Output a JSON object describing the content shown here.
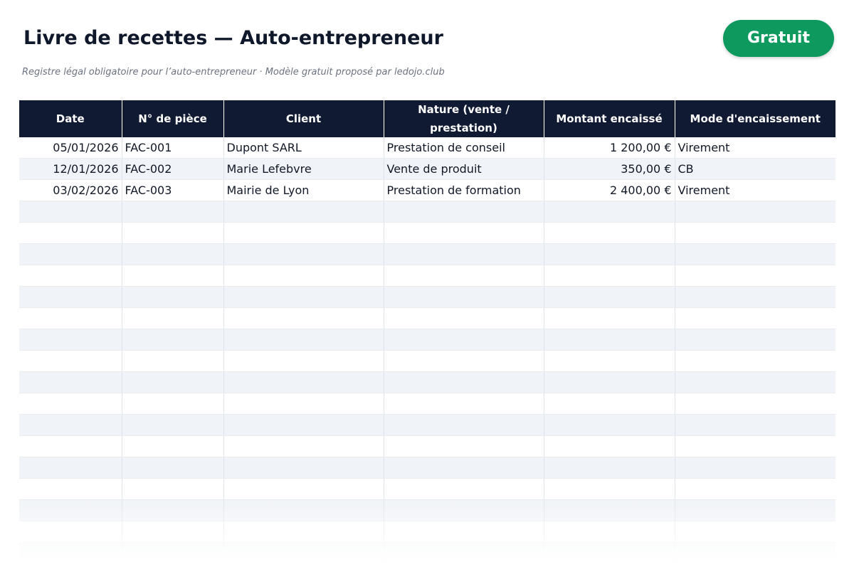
{
  "header": {
    "title": "Livre de recettes — Auto-entrepreneur",
    "subtitle": "Registre légal obligatoire pour l’auto-entrepreneur · Modèle gratuit proposé par ledojo.club",
    "badge": "Gratuit"
  },
  "colors": {
    "header_bg": "#111a33",
    "badge_bg": "#0e9a5f",
    "stripe": "#f0f3f7"
  },
  "table": {
    "columns": [
      "Date",
      "N° de pièce",
      "Client",
      "Nature (vente / prestation)",
      "Montant encaissé",
      "Mode d'encaissement"
    ],
    "rows": [
      [
        "05/01/2026",
        "FAC-001",
        "Dupont SARL",
        "Prestation de conseil",
        "1 200,00 €",
        "Virement"
      ],
      [
        "12/01/2026",
        "FAC-002",
        "Marie Lefebvre",
        "Vente de produit",
        "350,00 €",
        "CB"
      ],
      [
        "03/02/2026",
        "FAC-003",
        "Mairie de Lyon",
        "Prestation de formation",
        "2 400,00 €",
        "Virement"
      ]
    ],
    "empty_rows": 17
  }
}
